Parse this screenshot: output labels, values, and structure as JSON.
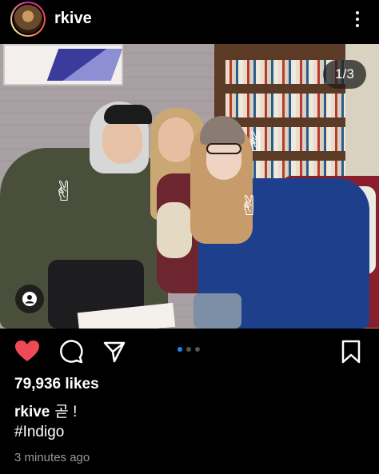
{
  "post": {
    "username": "rkive",
    "page_indicator": "1/3",
    "carousel": {
      "count": 3,
      "active": 1
    },
    "likes": "79,936 likes",
    "caption_user": "rkive",
    "caption_text": "곧 !",
    "hashtag": "#Indigo",
    "time": "3 minutes ago"
  },
  "icons": {
    "more": "more-vertical-icon",
    "like": "heart-icon",
    "comment": "comment-icon",
    "share": "send-icon",
    "save": "bookmark-icon",
    "tag": "user-tag-icon"
  },
  "colors": {
    "like": "#ed4956",
    "dot_active": "#1e88e5",
    "background": "#000000"
  }
}
